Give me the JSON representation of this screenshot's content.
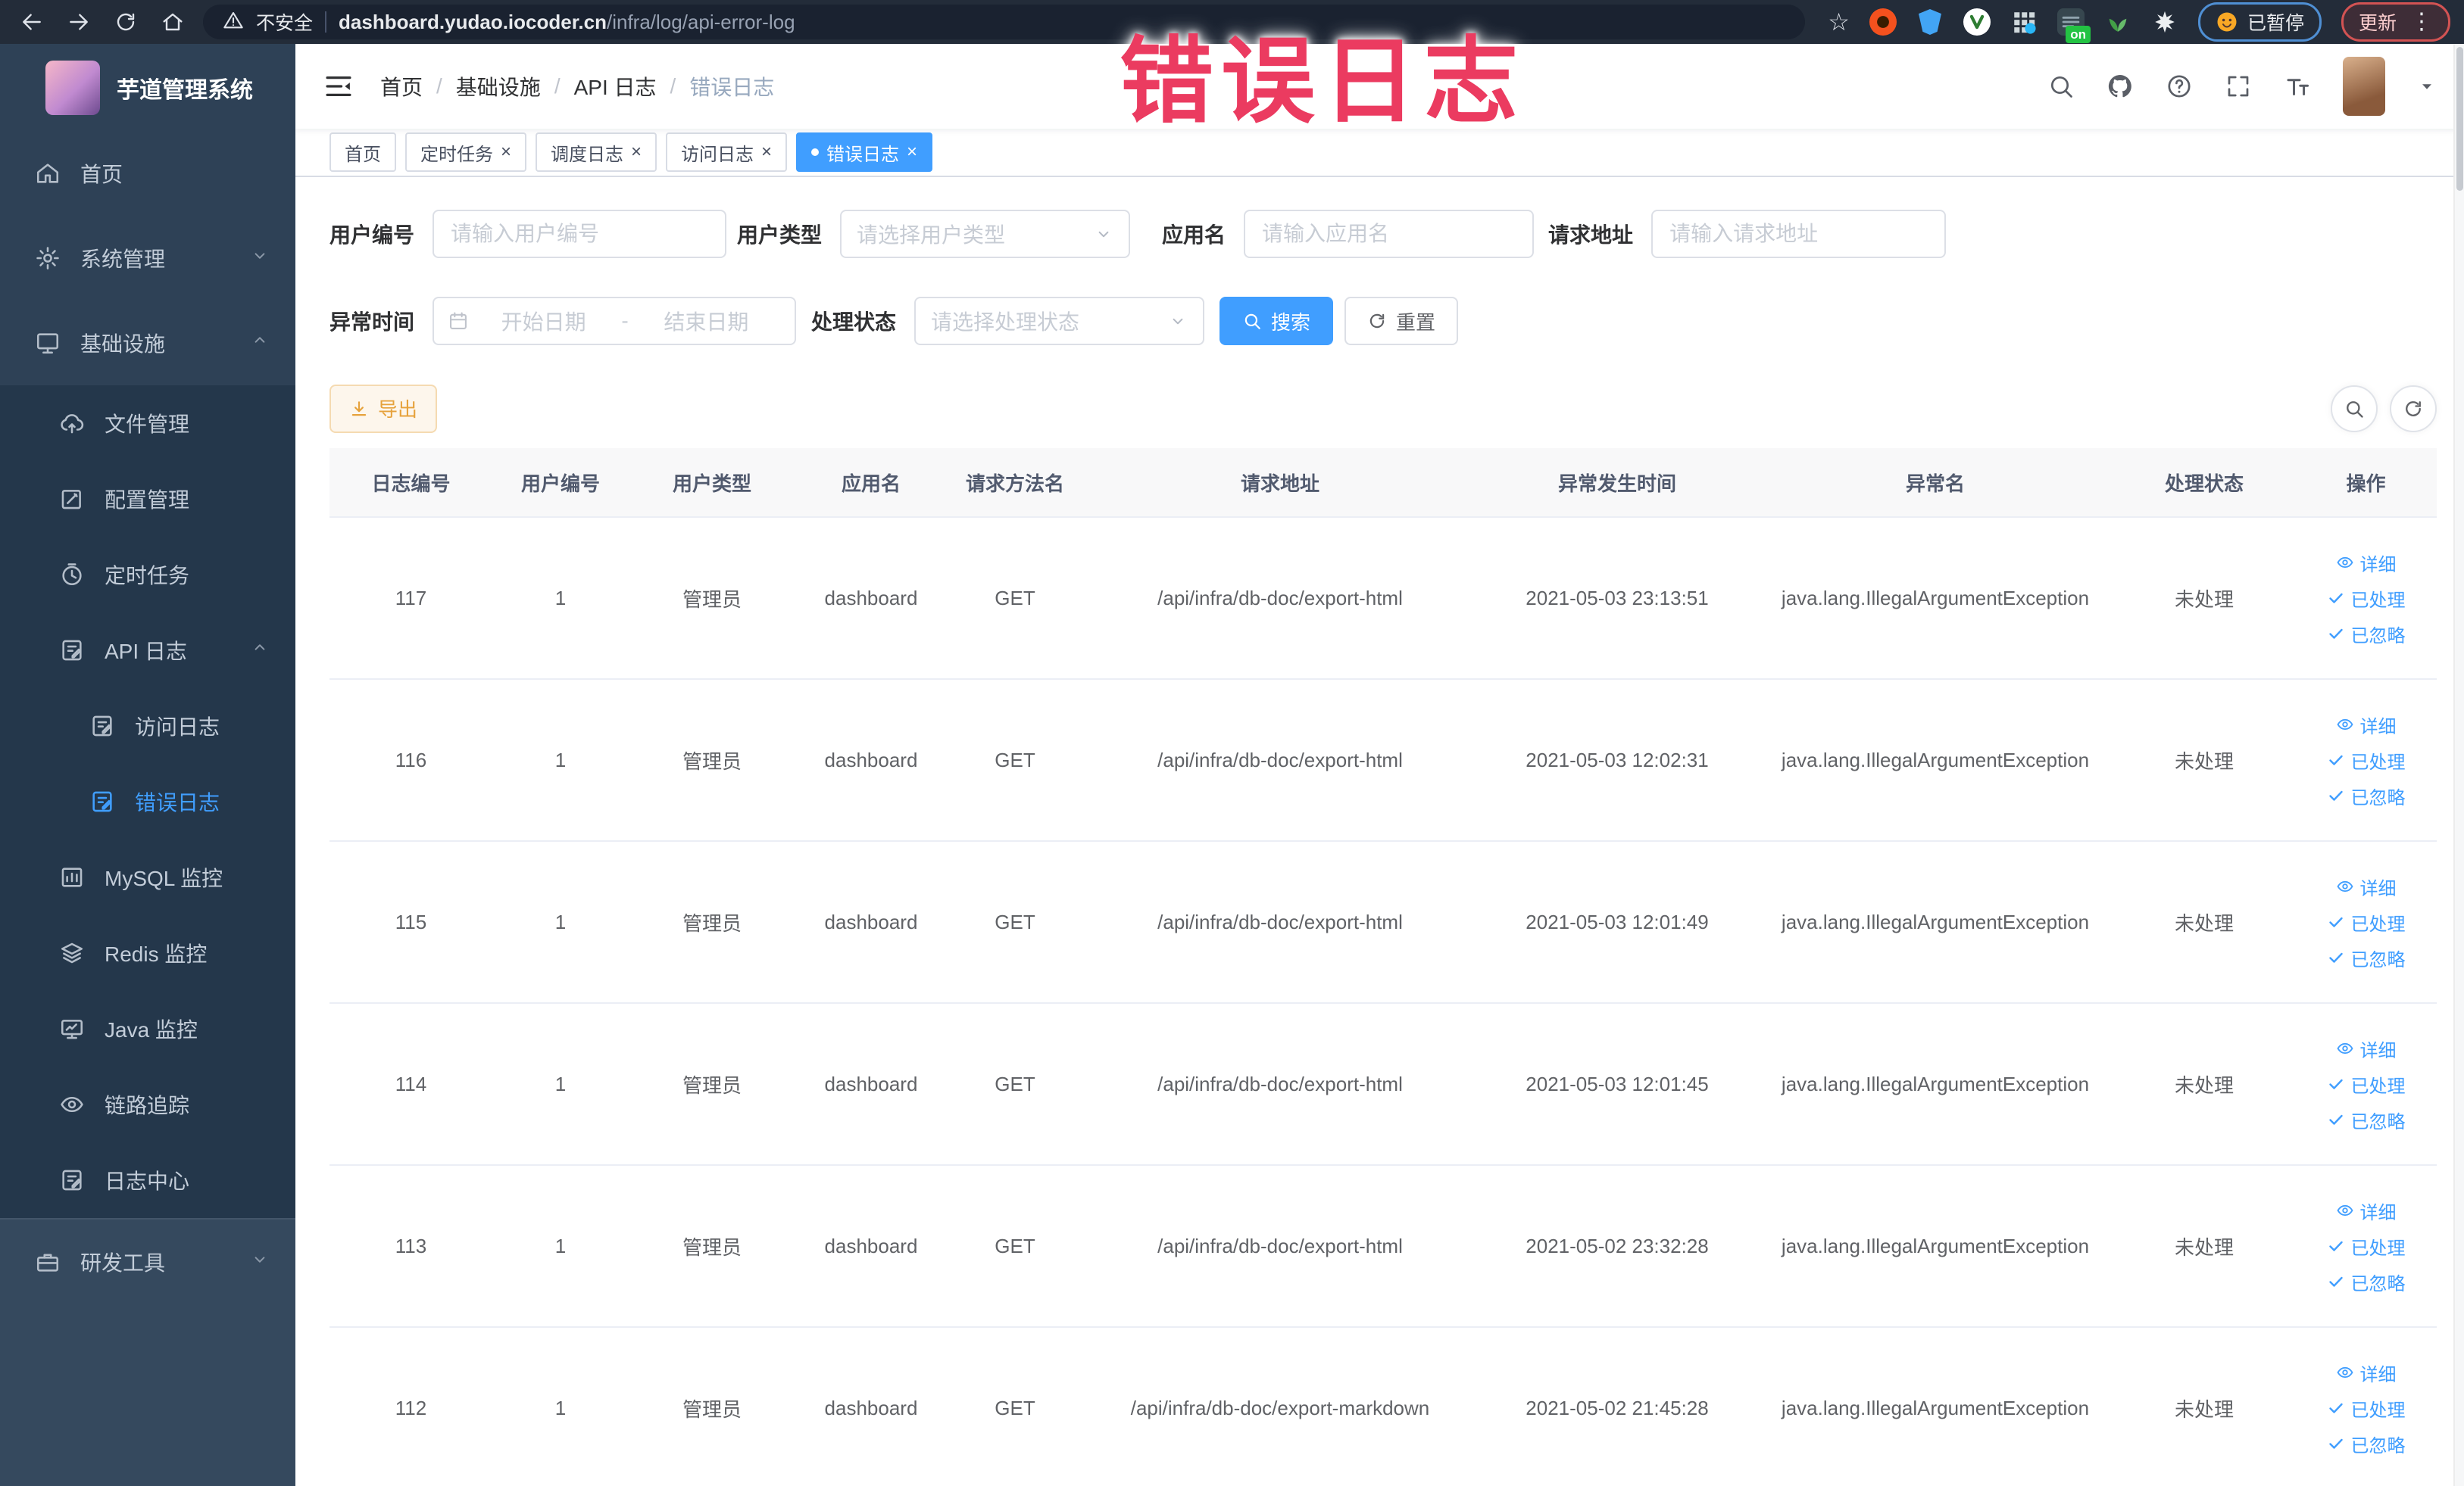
{
  "browser": {
    "security_label": "不安全",
    "url_host": "dashboard.yudao.iocoder.cn",
    "url_path": "/infra/log/api-error-log",
    "ext_badge": "on",
    "paused_label": "已暂停",
    "update_label": "更新"
  },
  "annotation": {
    "text": "错误日志",
    "color": "#eb3b60"
  },
  "sidebar": {
    "title": "芋道管理系统",
    "items": [
      {
        "slug": "home",
        "label": "首页",
        "icon": "home",
        "level": 0,
        "section": "top"
      },
      {
        "slug": "system-management",
        "label": "系统管理",
        "icon": "gear",
        "level": 0,
        "section": "top",
        "chevron": "down"
      },
      {
        "slug": "infrastructure",
        "label": "基础设施",
        "icon": "infra",
        "level": 0,
        "section": "top",
        "chevron": "up"
      },
      {
        "slug": "file-management",
        "label": "文件管理",
        "icon": "file",
        "level": 1,
        "section": "sub"
      },
      {
        "slug": "config-management",
        "label": "配置管理",
        "icon": "config",
        "level": 1,
        "section": "sub"
      },
      {
        "slug": "scheduled-tasks",
        "label": "定时任务",
        "icon": "timer",
        "level": 1,
        "section": "sub"
      },
      {
        "slug": "api-log",
        "label": "API 日志",
        "icon": "log",
        "level": 1,
        "section": "sub",
        "chevron": "up"
      },
      {
        "slug": "access-log",
        "label": "访问日志",
        "icon": "log",
        "level": 2,
        "section": "sub"
      },
      {
        "slug": "error-log",
        "label": "错误日志",
        "icon": "log",
        "level": 2,
        "section": "sub",
        "active": true
      },
      {
        "slug": "mysql-monitor",
        "label": "MySQL 监控",
        "icon": "chart",
        "level": 1,
        "section": "sub"
      },
      {
        "slug": "redis-monitor",
        "label": "Redis 监控",
        "icon": "layers",
        "level": 1,
        "section": "sub"
      },
      {
        "slug": "java-monitor",
        "label": "Java 监控",
        "icon": "screen",
        "level": 1,
        "section": "sub"
      },
      {
        "slug": "trace",
        "label": "链路追踪",
        "icon": "eye",
        "level": 1,
        "section": "sub"
      },
      {
        "slug": "log-center",
        "label": "日志中心",
        "icon": "log",
        "level": 1,
        "section": "sub"
      },
      {
        "slug": "dev-tools",
        "label": "研发工具",
        "icon": "tool",
        "level": 0,
        "section": "bottom",
        "chevron": "down"
      }
    ]
  },
  "header": {
    "breadcrumb": [
      "首页",
      "基础设施",
      "API 日志",
      "错误日志"
    ],
    "separator": "/"
  },
  "tabs": [
    {
      "slug": "home",
      "label": "首页",
      "closable": false,
      "active": false
    },
    {
      "slug": "scheduled-tasks",
      "label": "定时任务",
      "closable": true,
      "active": false
    },
    {
      "slug": "schedule-log",
      "label": "调度日志",
      "closable": true,
      "active": false
    },
    {
      "slug": "access-log",
      "label": "访问日志",
      "closable": true,
      "active": false
    },
    {
      "slug": "error-log",
      "label": "错误日志",
      "closable": true,
      "active": true
    }
  ],
  "filters": {
    "fields": [
      {
        "label": "用户编号",
        "placeholder": "请输入用户编号"
      },
      {
        "label": "用户类型",
        "placeholder": "请选择用户类型"
      },
      {
        "label": "应用名",
        "placeholder": "请输入应用名"
      },
      {
        "label": "请求地址",
        "placeholder": "请输入请求地址"
      },
      {
        "label": "异常时间",
        "placeholder_start": "开始日期",
        "placeholder_end": "结束日期",
        "separator": "-"
      },
      {
        "label": "处理状态",
        "placeholder": "请选择处理状态"
      }
    ],
    "search_label": "搜索",
    "reset_label": "重置"
  },
  "toolbar_row": {
    "export_label": "导出"
  },
  "table": {
    "columns": [
      "日志编号",
      "用户编号",
      "用户类型",
      "应用名",
      "请求方法名",
      "请求地址",
      "异常发生时间",
      "异常名",
      "处理状态",
      "操作"
    ],
    "rows": [
      [
        "117",
        "1",
        "管理员",
        "dashboard",
        "GET",
        "/api/infra/db-doc/export-html",
        "2021-05-03 23:13:51",
        "java.lang.IllegalArgumentException",
        "未处理"
      ],
      [
        "116",
        "1",
        "管理员",
        "dashboard",
        "GET",
        "/api/infra/db-doc/export-html",
        "2021-05-03 12:02:31",
        "java.lang.IllegalArgumentException",
        "未处理"
      ],
      [
        "115",
        "1",
        "管理员",
        "dashboard",
        "GET",
        "/api/infra/db-doc/export-html",
        "2021-05-03 12:01:49",
        "java.lang.IllegalArgumentException",
        "未处理"
      ],
      [
        "114",
        "1",
        "管理员",
        "dashboard",
        "GET",
        "/api/infra/db-doc/export-html",
        "2021-05-03 12:01:45",
        "java.lang.IllegalArgumentException",
        "未处理"
      ],
      [
        "113",
        "1",
        "管理员",
        "dashboard",
        "GET",
        "/api/infra/db-doc/export-html",
        "2021-05-02 23:32:28",
        "java.lang.IllegalArgumentException",
        "未处理"
      ],
      [
        "112",
        "1",
        "管理员",
        "dashboard",
        "GET",
        "/api/infra/db-doc/export-markdown",
        "2021-05-02 21:45:28",
        "java.lang.IllegalArgumentException",
        "未处理"
      ]
    ],
    "actions": [
      {
        "slug": "detail",
        "label": "详细",
        "icon": "eye-sm"
      },
      {
        "slug": "processed",
        "label": "已处理",
        "icon": "check-sm"
      },
      {
        "slug": "ignored",
        "label": "已忽略",
        "icon": "check-sm"
      }
    ]
  }
}
